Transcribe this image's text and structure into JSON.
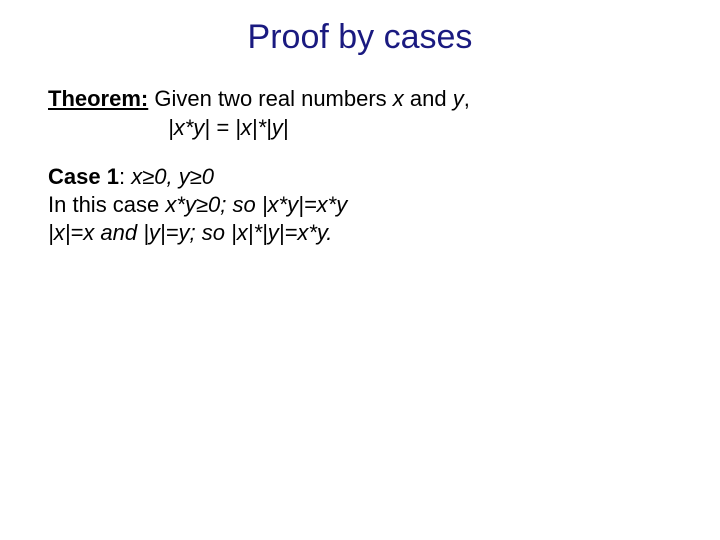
{
  "title": "Proof by cases",
  "theorem": {
    "label": "Theorem:",
    "text_before_vars": " Given two real numbers ",
    "var1": "x",
    "mid": " and ",
    "var2": "y",
    "after": ",",
    "equation": "|x*y| = |x|*|y|"
  },
  "case1": {
    "label": "Case 1",
    "colon": ": ",
    "cond": "x≥0, y≥0",
    "line2a": "In this case ",
    "line2b": "x*y≥0; so |x*y|=x*y",
    "line3": "|x|=x and |y|=y; so |x|*|y|=x*y."
  }
}
